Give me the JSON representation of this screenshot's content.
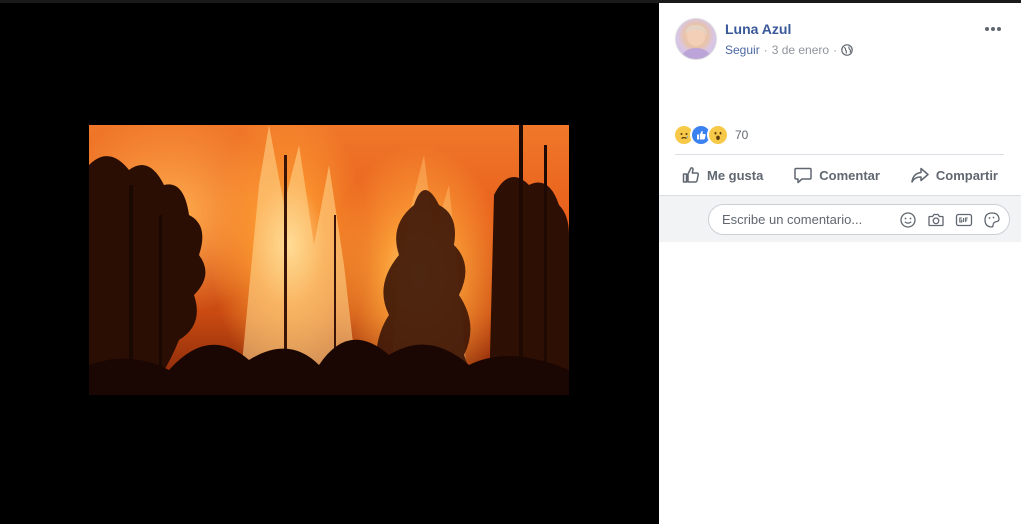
{
  "post": {
    "author": "Luna Azul",
    "follow_label": "Seguir",
    "separator": "·",
    "date": "3 de enero",
    "audience_icon": "globe-icon"
  },
  "reactions": {
    "types": [
      "sad-emoji",
      "like",
      "wow-emoji"
    ],
    "count": "70"
  },
  "actions": {
    "like_label": "Me gusta",
    "comment_label": "Comentar",
    "share_label": "Compartir"
  },
  "comment": {
    "placeholder": "Escribe un comentario...",
    "icons": [
      "emoji-icon",
      "camera-icon",
      "gif-icon",
      "sticker-icon"
    ]
  },
  "colors": {
    "author": "#385898",
    "meta": "#90949c",
    "action_text": "#606770",
    "viewer_bg": "#000000"
  }
}
